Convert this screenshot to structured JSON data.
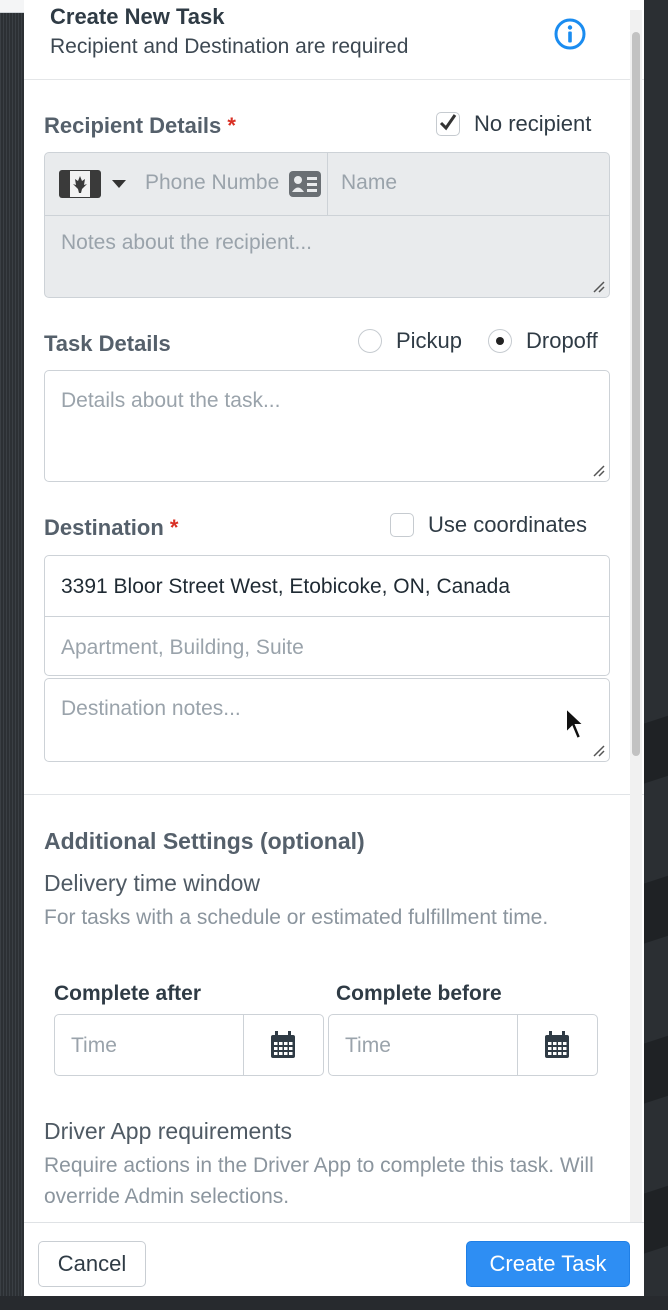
{
  "header": {
    "title": "Create New Task",
    "subtitle": "Recipient and Destination are required"
  },
  "recipient": {
    "label": "Recipient Details",
    "required_mark": "*",
    "no_recipient_label": "No recipient",
    "no_recipient_checked": true,
    "country_flag": "canada-flag",
    "phone_placeholder": "Phone Numbe",
    "name_placeholder": "Name",
    "notes_placeholder": "Notes about the recipient..."
  },
  "task": {
    "label": "Task Details",
    "pickup_label": "Pickup",
    "dropoff_label": "Dropoff",
    "selected": "Dropoff",
    "details_placeholder": "Details about the task..."
  },
  "destination": {
    "label": "Destination",
    "required_mark": "*",
    "use_coordinates_label": "Use coordinates",
    "address_value": "3391 Bloor Street West, Etobicoke, ON, Canada",
    "apartment_placeholder": "Apartment, Building, Suite",
    "notes_placeholder": "Destination notes..."
  },
  "additional": {
    "title": "Additional Settings (optional)",
    "time_window_title": "Delivery time window",
    "time_window_help": "For tasks with a schedule or estimated fulfillment time.",
    "complete_after_label": "Complete after",
    "complete_before_label": "Complete before",
    "time_placeholder": "Time",
    "driver_app_title": "Driver App requirements",
    "driver_app_help": "Require actions in the Driver App to complete this task. Will override Admin selections."
  },
  "footer": {
    "cancel_label": "Cancel",
    "create_label": "Create Task"
  },
  "colors": {
    "primary": "#2e8ef3",
    "required": "#d93025",
    "info": "#1a8cf0"
  }
}
